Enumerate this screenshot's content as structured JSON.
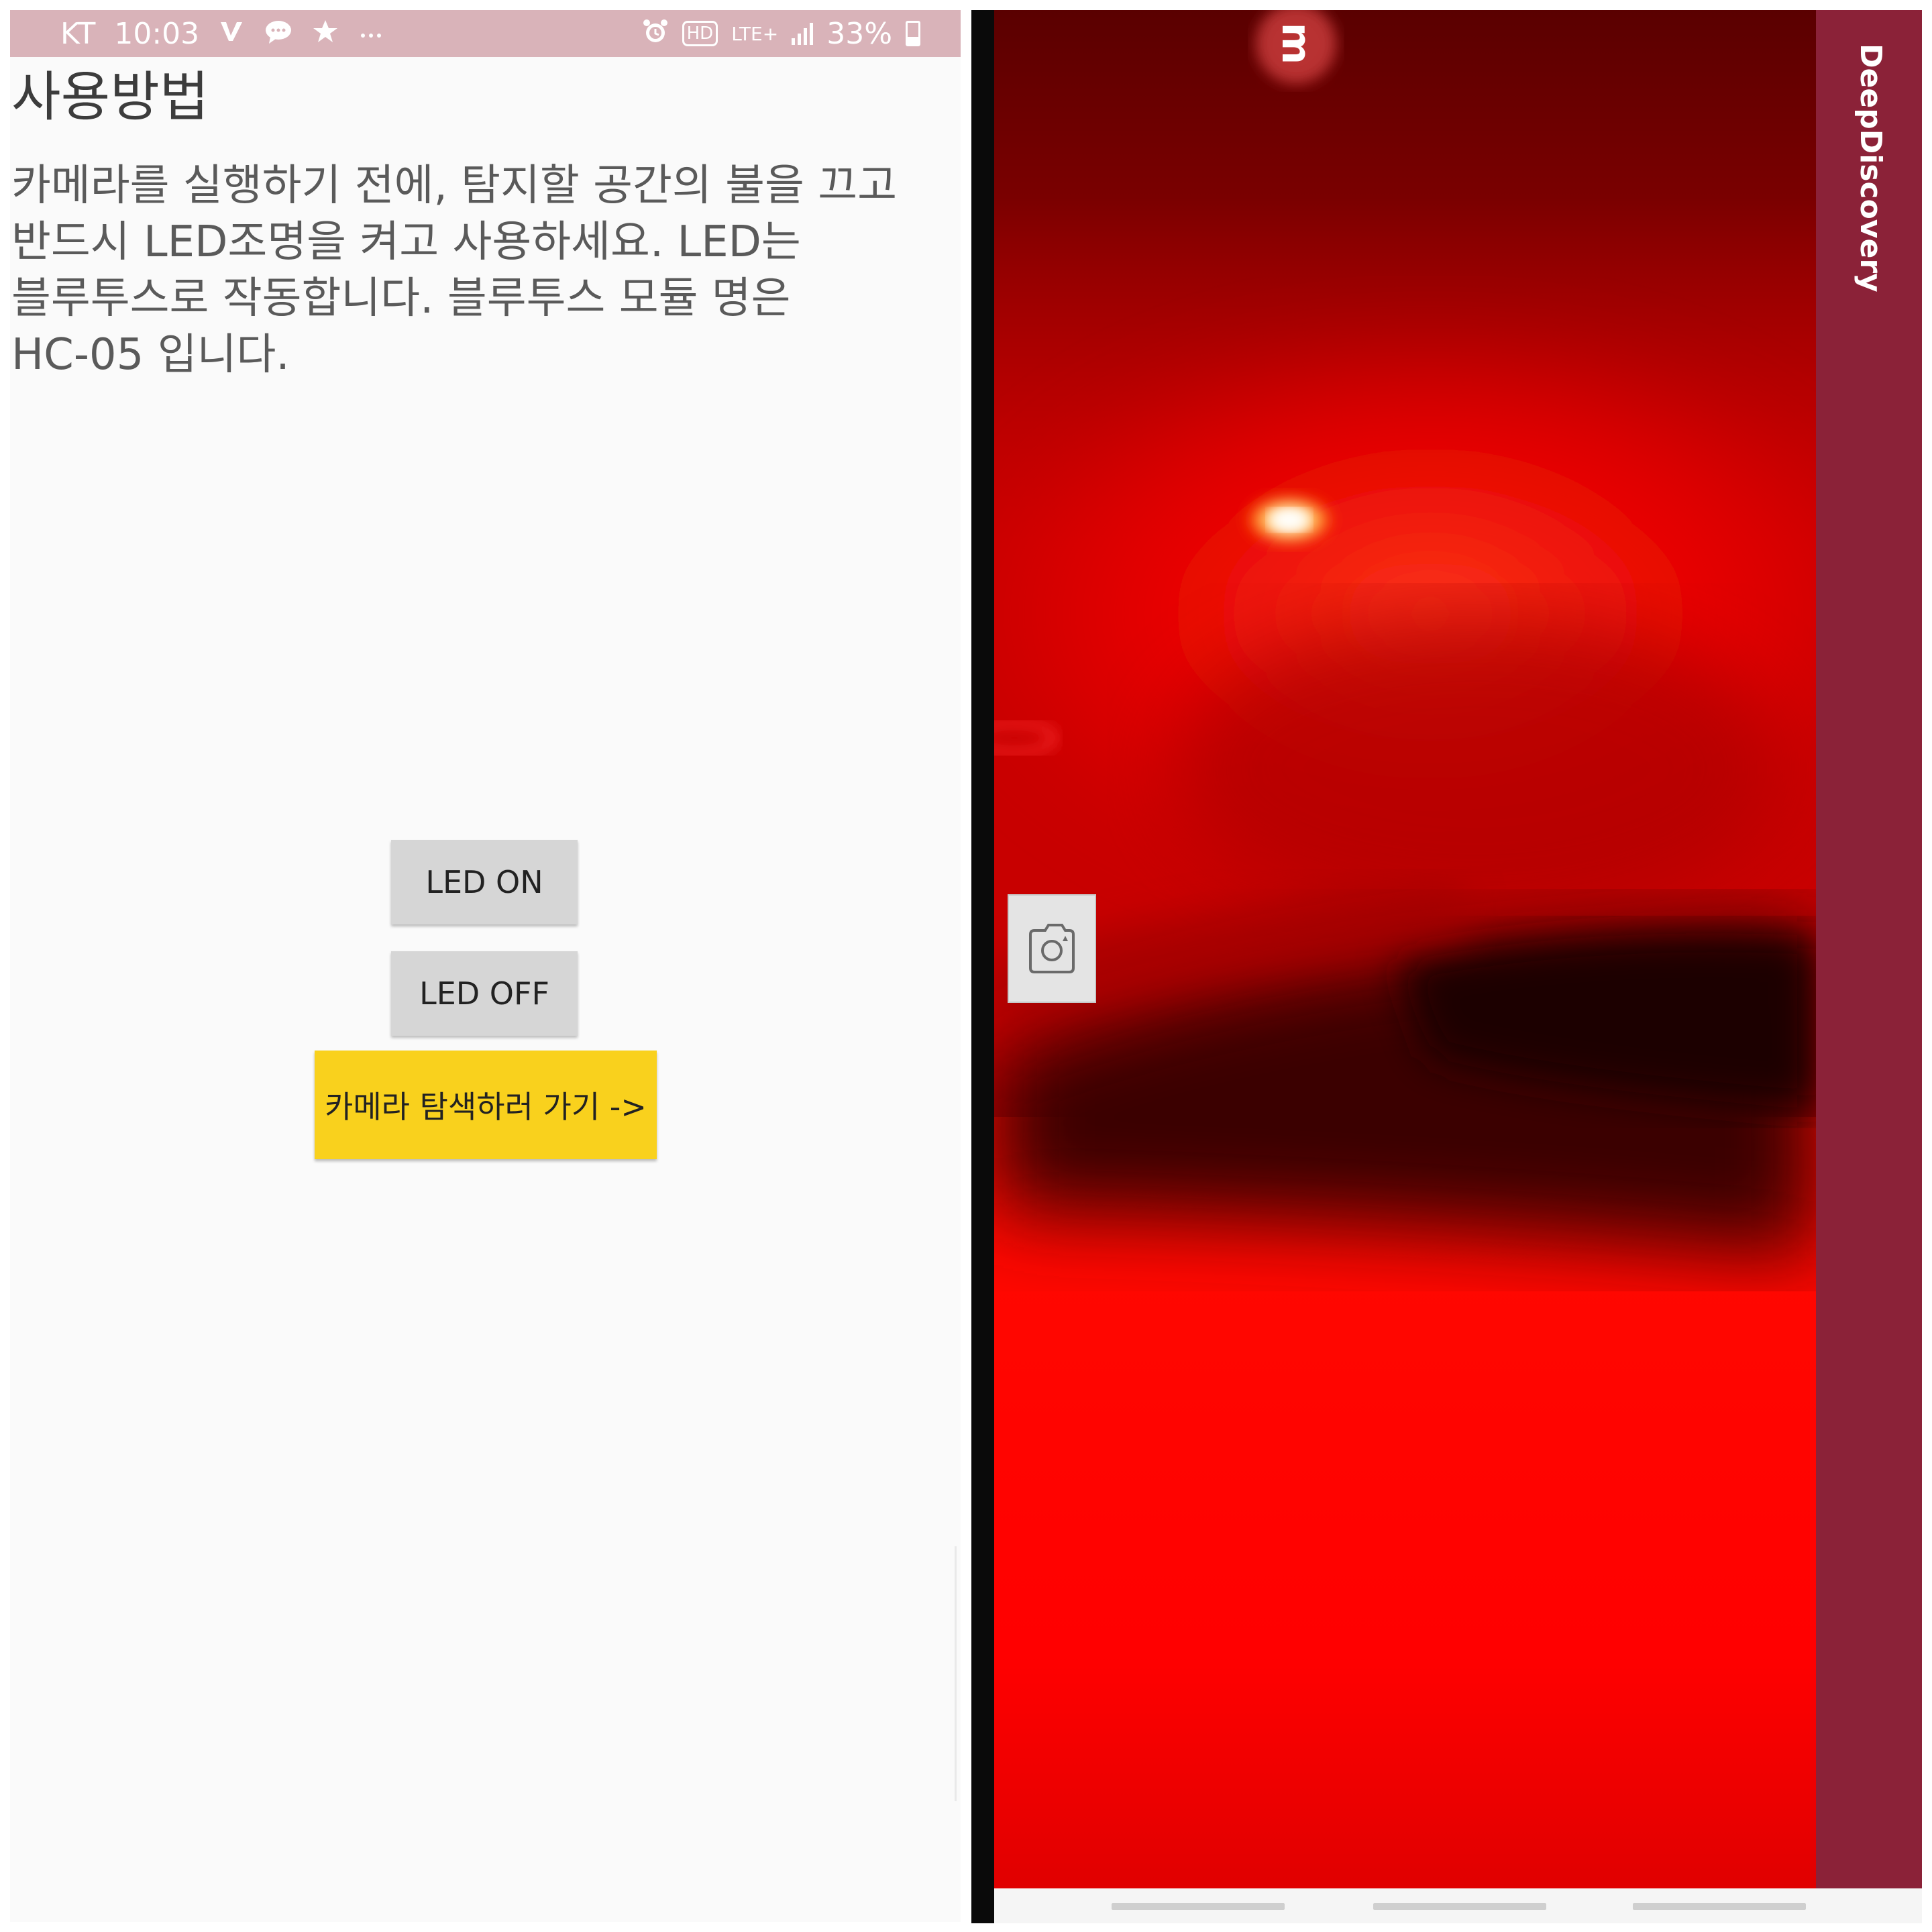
{
  "status_bar": {
    "carrier": "KT",
    "time": "10:03",
    "hd_badge": "HD",
    "network": "LTE+",
    "battery": "33%",
    "icons": [
      "v-app-icon",
      "chat-icon",
      "star-icon",
      "more-icon",
      "alarm-icon",
      "hd-icon",
      "lte-icon",
      "signal-icon",
      "battery-icon"
    ]
  },
  "left_screen": {
    "title": "사용방법",
    "instructions": [
      "카메라를 실행하기 전에,  탐지할 공간의 불을 끄고",
      "반드시 LED조명을 켜고 사용하세요. LED는",
      "블루투스로 작동합니다. 블루투스 모듈 명은",
      "HC-05 입니다."
    ],
    "buttons": {
      "led_on": "LED ON",
      "led_off": "LED OFF",
      "camera": "카메라 탐색하러 가기 ->"
    },
    "colors": {
      "background": "#fafafa",
      "status_bar": "#d9b3b9",
      "gray_button": "#d6d6d6",
      "camera_button": "#f9d11d"
    }
  },
  "right_screen": {
    "app_title": "DeepDiscovery",
    "capture_button_icon": "camera-switch-icon",
    "colors": {
      "app_bar": "#8b2238",
      "camera_feed": "#d40000"
    }
  }
}
